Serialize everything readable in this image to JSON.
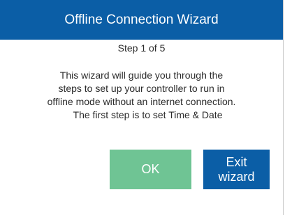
{
  "dialog": {
    "title": "Offline Connection Wizard",
    "step": "Step 1 of 5",
    "message_lines": [
      "This wizard will guide you through the",
      "steps to set up your controller to run in",
      "offline mode without an internet connection.",
      "The first step is to set Time & Date"
    ],
    "ok_label": "OK",
    "exit_label_line1": "Exit",
    "exit_label_line2": "wizard"
  },
  "colors": {
    "title_bar": "#0b5ea6",
    "ok_button": "#6fc494",
    "exit_button": "#0b5ea6"
  }
}
